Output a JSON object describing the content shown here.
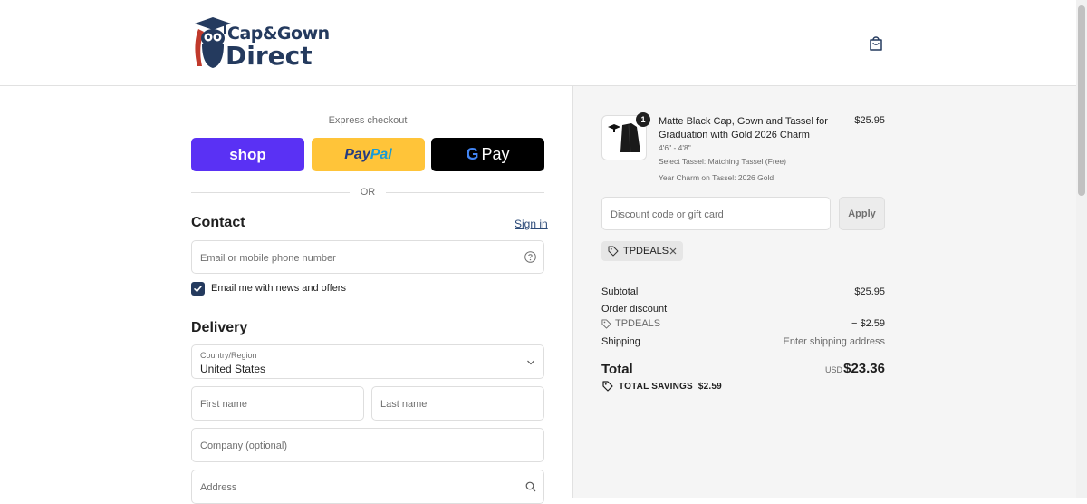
{
  "header": {
    "logo_line1": "Cap&Gown",
    "logo_line2": "Direct",
    "bag_icon": "shopping-bag-icon"
  },
  "express": {
    "label": "Express checkout",
    "shop_label": "shop",
    "paypal_part1": "Pay",
    "paypal_part2": "Pal",
    "gpay_g": "G",
    "gpay_label": "Pay",
    "or_text": "OR"
  },
  "contact": {
    "title": "Contact",
    "sign_in": "Sign in",
    "email_placeholder": "Email or mobile phone number",
    "newsletter_label": "Email me with news and offers",
    "newsletter_checked": true
  },
  "delivery": {
    "title": "Delivery",
    "country_label": "Country/Region",
    "country_value": "United States",
    "first_name_placeholder": "First name",
    "last_name_placeholder": "Last name",
    "company_placeholder": "Company (optional)",
    "address_placeholder": "Address"
  },
  "order": {
    "item": {
      "quantity": "1",
      "title": "Matte Black Cap, Gown and Tassel for Graduation with Gold 2026 Charm",
      "size": "4'6\" - 4'8\"",
      "tassel": "Select Tassel: Matching Tassel (Free)",
      "charm": "Year Charm on Tassel: 2026 Gold",
      "price": "$25.95"
    },
    "discount_placeholder": "Discount code or gift card",
    "apply_label": "Apply",
    "applied_code": "TPDEALS",
    "subtotal_label": "Subtotal",
    "subtotal_value": "$25.95",
    "order_discount_label": "Order discount",
    "discount_code": "TPDEALS",
    "discount_value": "− $2.59",
    "shipping_label": "Shipping",
    "shipping_value": "Enter shipping address",
    "total_label": "Total",
    "total_currency": "USD",
    "total_value": "$23.36",
    "savings_label": "TOTAL SAVINGS",
    "savings_value": "$2.59"
  },
  "colors": {
    "brand": "#243a5e",
    "shop": "#5a31f4",
    "paypal": "#ffc439",
    "gpay": "#000000"
  }
}
